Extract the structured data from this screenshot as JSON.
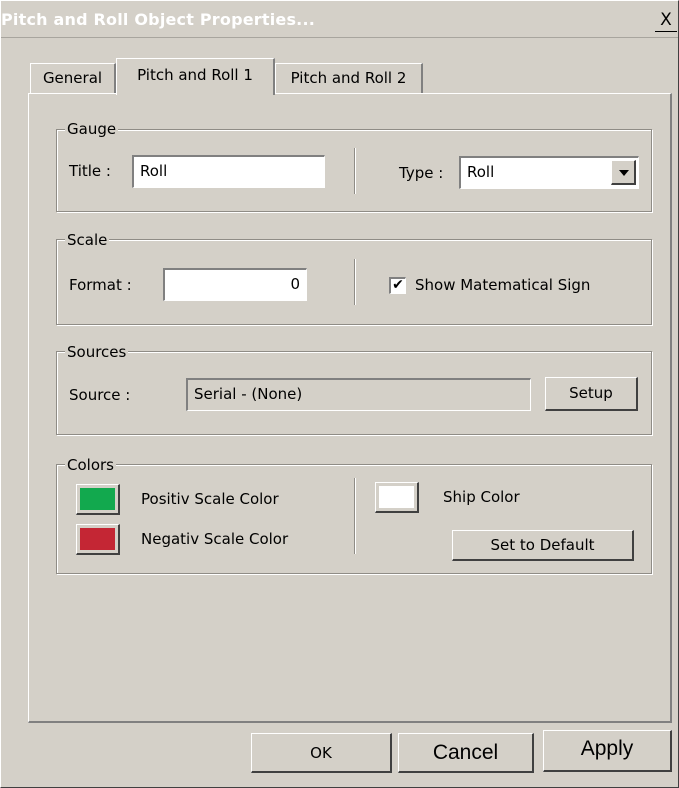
{
  "window": {
    "title": "Pitch and Roll Object Properties...",
    "close_label": "X"
  },
  "tabs": [
    {
      "label": "General",
      "active": false
    },
    {
      "label": "Pitch and Roll 1",
      "active": true
    },
    {
      "label": "Pitch and Roll 2",
      "active": false
    }
  ],
  "gauge": {
    "legend": "Gauge",
    "title_label": "Title :",
    "title_value": "Roll",
    "type_label": "Type :",
    "type_value": "Roll"
  },
  "scale": {
    "legend": "Scale",
    "format_label": "Format :",
    "format_value": "0",
    "show_sign_label": "Show Matematical Sign",
    "show_sign_checked": true,
    "check_mark": "✔"
  },
  "sources": {
    "legend": "Sources",
    "source_label": "Source :",
    "source_value": "Serial - (None)",
    "setup_label": "Setup"
  },
  "colors": {
    "legend": "Colors",
    "positive_label": "Positiv Scale Color",
    "positive_color": "#12a94e",
    "negative_label": "Negativ Scale Color",
    "negative_color": "#c42634",
    "ship_label": "Ship Color",
    "ship_color": "#ffffff",
    "default_label": "Set to Default"
  },
  "footer": {
    "ok_label": "OK",
    "cancel_label": "Cancel",
    "apply_label": "Apply"
  }
}
